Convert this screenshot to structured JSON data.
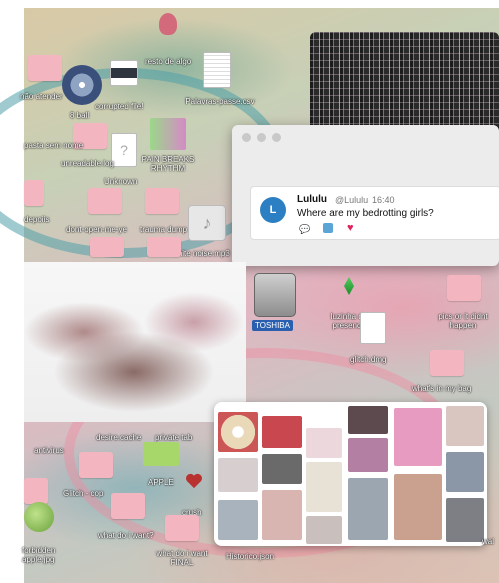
{
  "desktop_labels": {
    "nao_atender": "não atender",
    "corrupted_file": "corrupted file!",
    "resto_de_algo": "resto de algo",
    "ball_8": "8 ball",
    "palavras_passe": "Palavras-passe.csv",
    "pasta_sem_nome": "pasta sem nome",
    "unreadable": "unreadable.log",
    "pain_breaks": "PAIN BREAKS RHYTHM",
    "unknown": "Unknown",
    "depoiis": "depoiis",
    "dont_open": "dont-open-me-ye",
    "trauma_dump": "trauma dump",
    "white_noise": "white noise.mp3",
    "toshiba": "TOSHIBA",
    "luzinha": "luzinha de presence",
    "pics": "pics or it didnt happen",
    "glitch_dmg": "glitch.dmg",
    "whats_in_my_bag": "what's in my bag",
    "desire_cache": "desire.cache",
    "private_tab": "private tab",
    "antivirus": "antivirus",
    "apple": "APPLE",
    "glitch_cop": "Glitch - cop",
    "crush": "crush",
    "forbidden_apple": "forbidden apple.jpg",
    "what_do_i_want": "what do i want?",
    "what_do_i_want_final": "what do i want FINAL",
    "historico": "Historico.json",
    "partial_right": "wal"
  },
  "tweet": {
    "avatar_letter": "L",
    "name": "Lululu",
    "handle": "@Lululu",
    "time": "16:40",
    "text": "Where are my bedrotting girls?"
  },
  "icons": {
    "reply": "reply-icon",
    "retweet": "retweet-icon",
    "like": "heart-icon"
  },
  "colors": {
    "folder": "#f3b6c1",
    "twitter_blue": "#2c7fc2",
    "like_red": "#e0245e"
  }
}
